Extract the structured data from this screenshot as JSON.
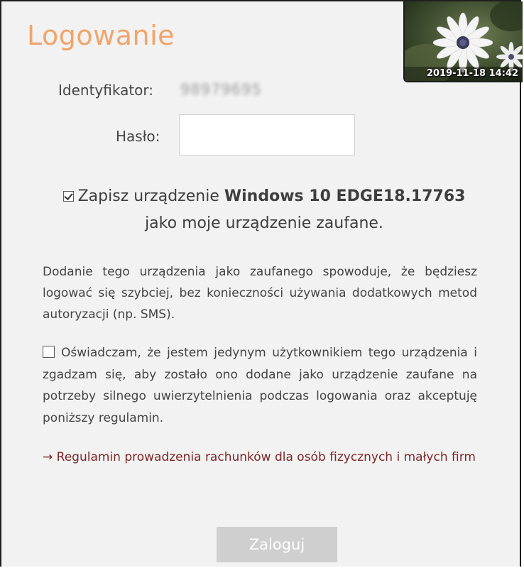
{
  "title": "Logowanie",
  "photo": {
    "icon": "daisy-flower-photo",
    "timestamp": "2019-11-18 14:42"
  },
  "identifier": {
    "label": "Identyfikator:",
    "value": "98979695"
  },
  "password": {
    "label": "Hasło:",
    "value": ""
  },
  "trusted_device": {
    "checked": true,
    "text_before": "Zapisz urządzenie ",
    "device_name": "Windows 10 EDGE18.17763",
    "text_after": "jako moje urządzenie zaufane."
  },
  "info_text": "Dodanie tego urządzenia jako zaufanego spowoduje, że będziesz logować się szybciej, bez konieczności używania dodatkowych metod autoryzacji (np. SMS).",
  "declaration": {
    "checked": false,
    "text": "Oświadczam, że jestem jedynym użytkownikiem tego urządzenia i zgadzam się, aby zostało ono dodane jako urządzenie zaufane na potrzeby silnego uwierzytelnienia podczas logowania oraz akceptuję poniższy regulamin."
  },
  "regulations_link": "→ Regulamin prowadzenia rachunków dla osób fizycznych i małych firm",
  "login_button": "Zaloguj",
  "colors": {
    "title": "#f0a56b",
    "link": "#7d2525",
    "button_disabled": "#cfcfcf",
    "background": "#f2f2f2"
  }
}
